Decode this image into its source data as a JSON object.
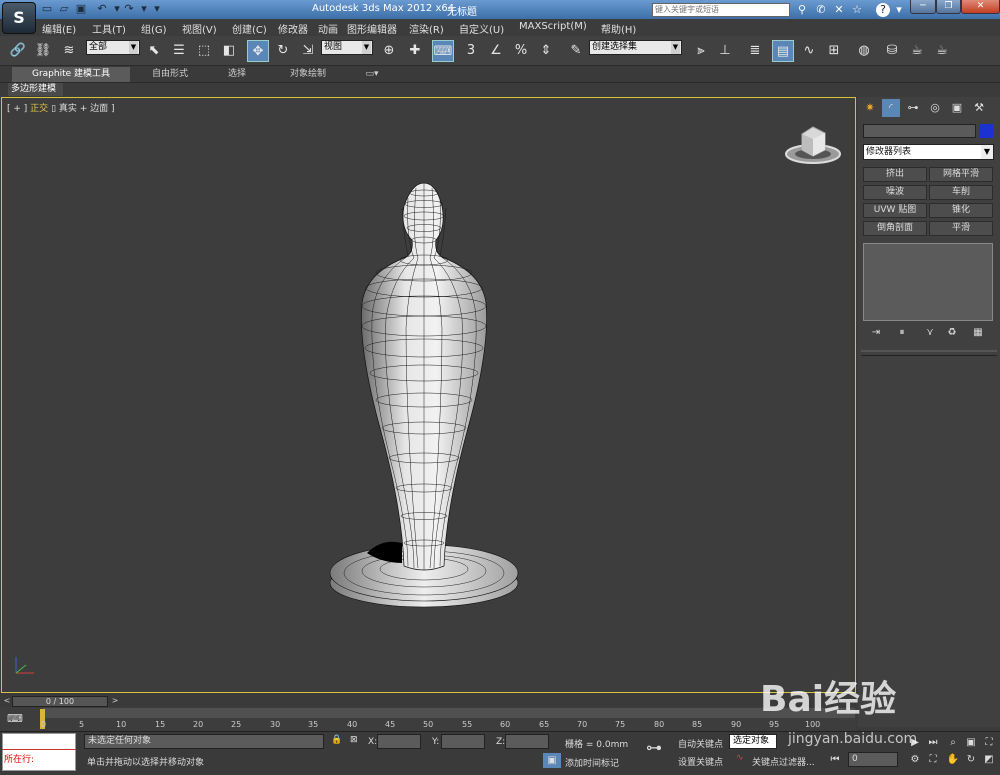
{
  "app": {
    "title": "Autodesk 3ds Max  2012 x64",
    "document": "无标题",
    "logo_letter": "S",
    "search_placeholder": "键入关键字或短语"
  },
  "menus": [
    "编辑(E)",
    "工具(T)",
    "组(G)",
    "视图(V)",
    "创建(C)",
    "修改器",
    "动画",
    "图形编辑器",
    "渲染(R)",
    "自定义(U)",
    "MAXScript(M)",
    "帮助(H)"
  ],
  "toolbar": {
    "selection_filter": "全部",
    "reference_coord": "视图",
    "named_selection": "创建选择集"
  },
  "ribbon": {
    "tabs": [
      "Graphite 建模工具",
      "自由形式",
      "选择",
      "对象绘制"
    ],
    "panel": "多边形建模"
  },
  "viewport": {
    "label_open": "[ + ]",
    "label_view": "正交",
    "label_shading": "真实",
    "label_edges": "+ 边面 ]",
    "border_color": "#d7c33a"
  },
  "command_panel": {
    "modifier_list": "修改器列表",
    "buttons": [
      "挤出",
      "网格平滑",
      "噪波",
      "车削",
      "UVW 贴图",
      "锥化",
      "倒角剖面",
      "平滑"
    ],
    "object_color": "#1c32d0"
  },
  "timeline": {
    "frame_display": "0 / 100",
    "ticks": [
      "0",
      "5",
      "10",
      "15",
      "20",
      "25",
      "30",
      "35",
      "40",
      "45",
      "50",
      "55",
      "60",
      "65",
      "70",
      "75",
      "80",
      "85",
      "90",
      "95",
      "100"
    ]
  },
  "status": {
    "running": "所在行:",
    "selection": "未选定任何对象",
    "prompt": "单击并拖动以选择并移动对象",
    "x_label": "X:",
    "y_label": "Y:",
    "z_label": "Z:",
    "grid": "栅格 = 0.0mm",
    "add_time_tag": "添加时间标记",
    "auto_key": "自动关键点",
    "set_key": "设置关键点",
    "key_mode": "选定对象",
    "key_filters": "关键点过滤器...",
    "frame_value": "0"
  },
  "watermark": {
    "brand": "Bai经验",
    "url": "jingyan.baidu.com"
  }
}
